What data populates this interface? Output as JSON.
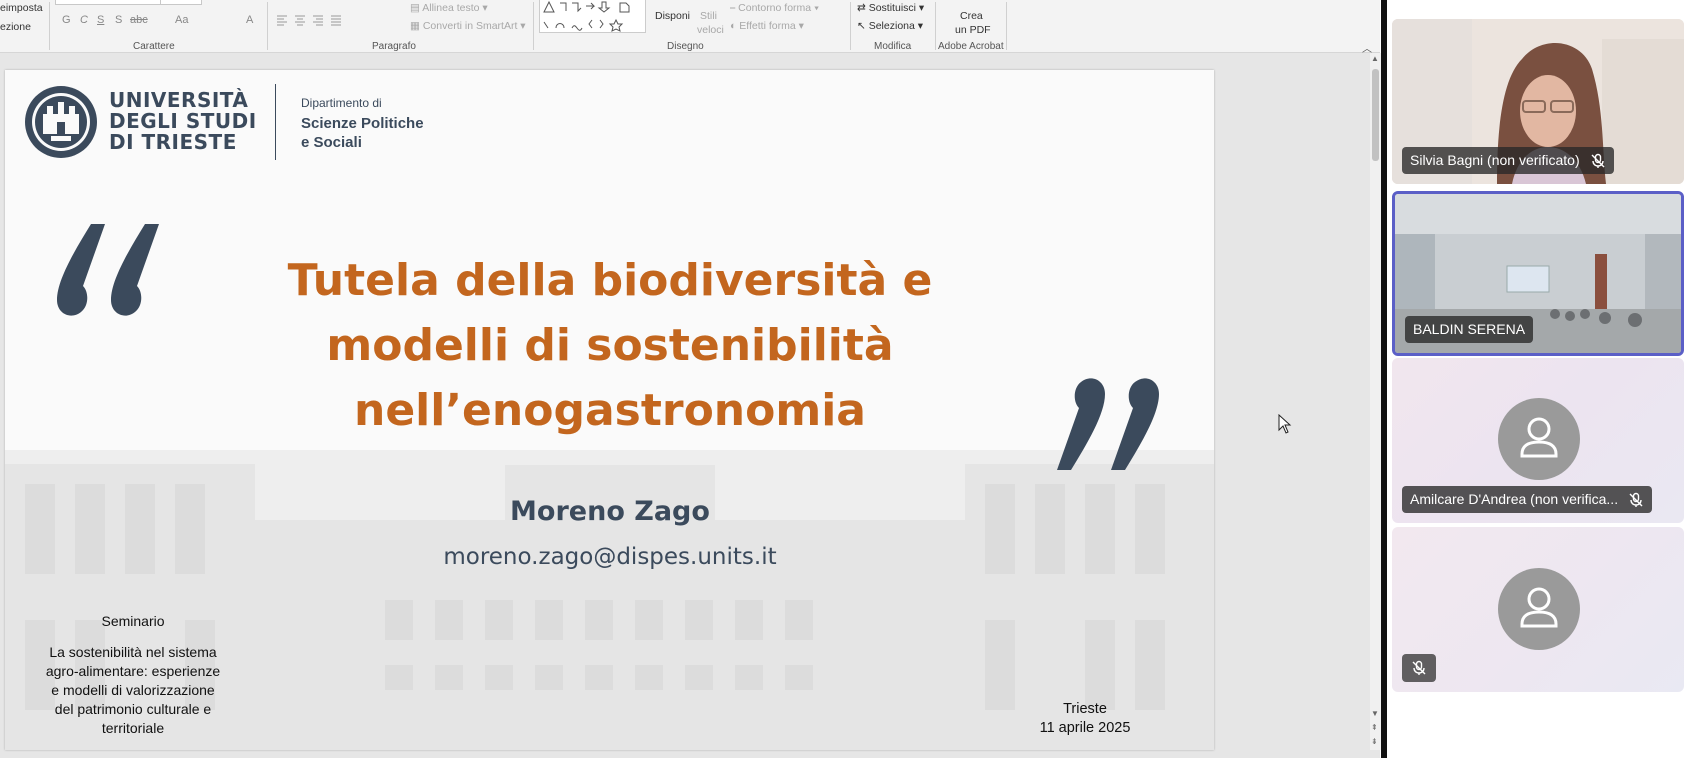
{
  "ribbon": {
    "left_top": "eimposta",
    "left_bottom": "ezione",
    "groups": {
      "carattere": "Carattere",
      "paragrafo": "Paragrafo",
      "disegno": "Disegno",
      "modifica": "Modifica",
      "acrobat": "Adobe Acrobat"
    },
    "allinea_testo": "Allinea testo",
    "converti_smartart": "Converti in SmartArt",
    "disponi": "Disponi",
    "stili_veloci_1": "Stili",
    "stili_veloci_2": "veloci",
    "contorno_forma": "Contorno forma",
    "effetti_forma": "Effetti forma",
    "sostituisci": "Sostituisci",
    "seleziona": "Seleziona",
    "crea_pdf_1": "Crea",
    "crea_pdf_2": "un PDF",
    "font_buttons": [
      "G",
      "C",
      "S",
      "S",
      "abc",
      "Aa"
    ]
  },
  "slide": {
    "uni_line1": "UNIVERSITÀ",
    "uni_line2": "DEGLI STUDI",
    "uni_line3": "DI TRIESTE",
    "dept_line1": "Dipartimento di",
    "dept_line2": "Scienze Politiche",
    "dept_line3": "e Sociali",
    "title_line1": "Tutela della biodiversità e",
    "title_line2": "modelli di sostenibilità",
    "title_line3": "nell’enogastronomia",
    "author": "Moreno Zago",
    "email": "moreno.zago@dispes.units.it",
    "seminar_label": "Seminario",
    "seminar_desc_1": "La sostenibilità nel sistema",
    "seminar_desc_2": "agro-alimentare: esperienze",
    "seminar_desc_3": "e modelli di valorizzazione",
    "seminar_desc_4": "del patrimonio culturale e",
    "seminar_desc_5": "territoriale",
    "place": "Trieste",
    "date": "11 aprile 2025",
    "colors": {
      "title": "#c3661e",
      "navy": "#3b4a5c"
    }
  },
  "participants": [
    {
      "name": "Silvia Bagni (non verificato)",
      "muted": true
    },
    {
      "name": "BALDIN SERENA",
      "active_speaker": true
    },
    {
      "name": "Amilcare D'Andrea (non verifica...",
      "muted": true
    },
    {
      "name": "",
      "muted": true
    }
  ]
}
